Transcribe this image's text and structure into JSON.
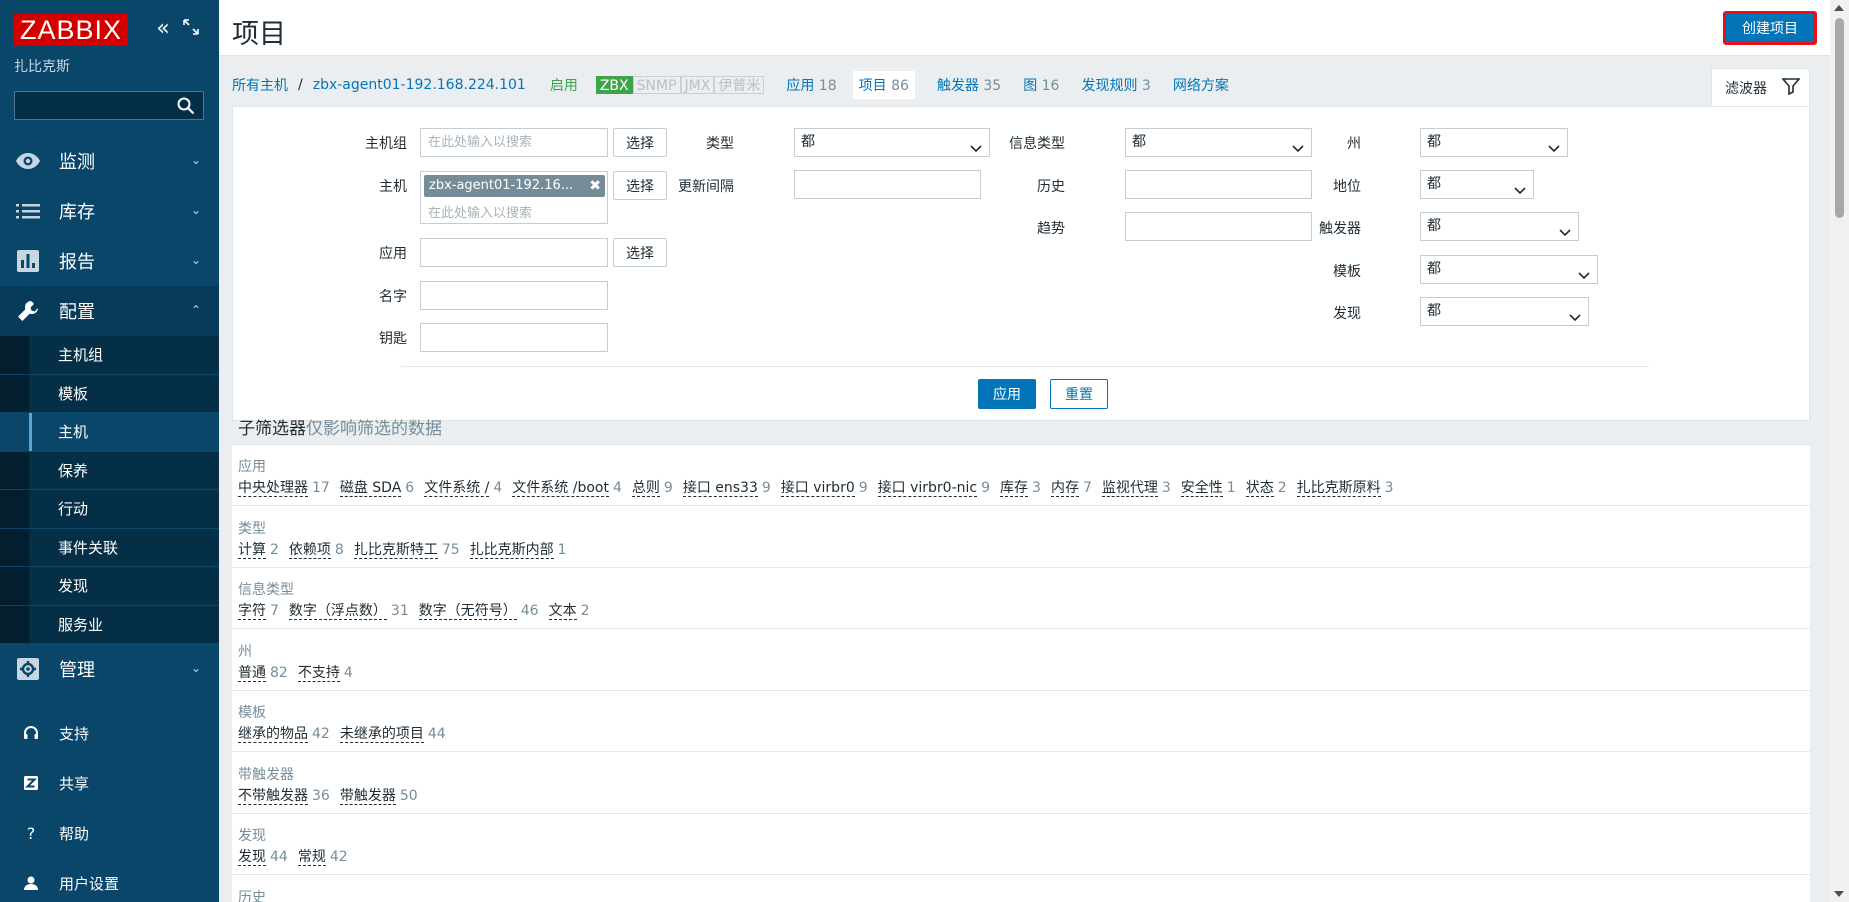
{
  "sidebar": {
    "logo": "ZABBIX",
    "subtitle": "扎比克斯",
    "search_value": "",
    "menu": [
      {
        "label": "监测",
        "icon": "eye-icon"
      },
      {
        "label": "库存",
        "icon": "list-icon"
      },
      {
        "label": "报告",
        "icon": "bar-chart-icon"
      },
      {
        "label": "配置",
        "icon": "wrench-icon"
      }
    ],
    "config_sub": [
      "主机组",
      "模板",
      "主机",
      "保养",
      "行动",
      "事件关联",
      "发现",
      "服务业"
    ],
    "admin_label": "管理",
    "bottom": [
      {
        "label": "支持",
        "icon": "headset-icon"
      },
      {
        "label": "共享",
        "icon": "share-icon"
      },
      {
        "label": "帮助",
        "icon": "help-icon"
      },
      {
        "label": "用户设置",
        "icon": "user-icon"
      }
    ]
  },
  "header": {
    "title": "项目",
    "create_button": "创建项目"
  },
  "nav": {
    "all_hosts": "所有主机",
    "separator": "/",
    "host": "zbx-agent01-192.168.224.101",
    "status": "启用",
    "tags": [
      "ZBX",
      "SNMP",
      "JMX",
      "伊普米"
    ],
    "tabs": [
      {
        "label": "应用",
        "count": "18"
      },
      {
        "label": "项目",
        "count": "86"
      },
      {
        "label": "触发器",
        "count": "35"
      },
      {
        "label": "图",
        "count": "16"
      },
      {
        "label": "发现规则",
        "count": "3"
      },
      {
        "label": "网络方案",
        "count": ""
      }
    ]
  },
  "filter": {
    "tab_label": "滤波器",
    "labels": {
      "hostgroup": "主机组",
      "host": "主机",
      "application": "应用",
      "name": "名字",
      "key": "钥匙",
      "type": "类型",
      "update_interval": "更新间隔",
      "info_type": "信息类型",
      "history": "历史",
      "trends": "趋势",
      "state": "州",
      "status": "地位",
      "triggers": "触发器",
      "template": "模板",
      "discovery": "发现"
    },
    "placeholder": "在此处输入以搜索",
    "select_button": "选择",
    "host_chip": "zbx-agent01-192.16...",
    "selects": {
      "type": "都",
      "info_type": "都",
      "state": "都",
      "status": "都",
      "triggers": "都",
      "template": "都",
      "discovery": "都"
    },
    "apply": "应用",
    "reset": "重置"
  },
  "subfilter": {
    "title": "子筛选器",
    "hint": "仅影响筛选的数据",
    "groups": [
      {
        "title": "应用",
        "items": [
          {
            "label": "中央处理器",
            "count": "17"
          },
          {
            "label": "磁盘 SDA",
            "count": "6"
          },
          {
            "label": "文件系统 /",
            "count": "4"
          },
          {
            "label": "文件系统 /boot",
            "count": "4"
          },
          {
            "label": "总则",
            "count": "9"
          },
          {
            "label": "接口 ens33",
            "count": "9"
          },
          {
            "label": "接口 virbr0",
            "count": "9"
          },
          {
            "label": "接口 virbr0-nic",
            "count": "9"
          },
          {
            "label": "库存",
            "count": "3"
          },
          {
            "label": "内存",
            "count": "7"
          },
          {
            "label": "监视代理",
            "count": "3"
          },
          {
            "label": "安全性",
            "count": "1"
          },
          {
            "label": "状态",
            "count": "2"
          },
          {
            "label": "扎比克斯原料",
            "count": "3"
          }
        ]
      },
      {
        "title": "类型",
        "items": [
          {
            "label": "计算",
            "count": "2"
          },
          {
            "label": "依赖项",
            "count": "8"
          },
          {
            "label": "扎比克斯特工",
            "count": "75"
          },
          {
            "label": "扎比克斯内部",
            "count": "1"
          }
        ]
      },
      {
        "title": "信息类型",
        "items": [
          {
            "label": "字符",
            "count": "7"
          },
          {
            "label": "数字（浮点数）",
            "count": "31"
          },
          {
            "label": "数字（无符号）",
            "count": "46"
          },
          {
            "label": "文本",
            "count": "2"
          }
        ]
      },
      {
        "title": "州",
        "items": [
          {
            "label": "普通",
            "count": "82"
          },
          {
            "label": "不支持",
            "count": "4"
          }
        ]
      },
      {
        "title": "模板",
        "items": [
          {
            "label": "继承的物品",
            "count": "42"
          },
          {
            "label": "未继承的项目",
            "count": "44"
          }
        ]
      },
      {
        "title": "带触发器",
        "items": [
          {
            "label": "不带触发器",
            "count": "36"
          },
          {
            "label": "带触发器",
            "count": "50"
          }
        ]
      },
      {
        "title": "发现",
        "items": [
          {
            "label": "发现",
            "count": "44"
          },
          {
            "label": "常规",
            "count": "42"
          }
        ]
      },
      {
        "title": "历史",
        "items": []
      }
    ]
  },
  "colors": {
    "sidebar_bg": "#0a466a",
    "accent": "#0275b8",
    "logo_red": "#d40000",
    "enabled_green": "#3ea44a",
    "highlight_border": "#e8101a"
  }
}
